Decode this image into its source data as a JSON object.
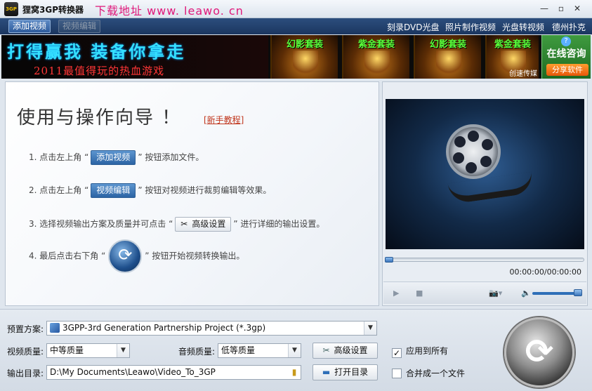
{
  "window": {
    "title": "狸窝3GP转换器",
    "logo_text": "3GP",
    "promo_text": "下载地址 www. leawo. cn",
    "controls": {
      "minimize": "—",
      "maximize": "▫",
      "close": "✕"
    }
  },
  "toolbar": {
    "add_video": "添加视频",
    "edit_video": "视频编辑",
    "links": [
      "刻录DVD光盘",
      "照片制作视频",
      "光盘转视频",
      "德州扑克"
    ]
  },
  "banner": {
    "slogan": "打得赢我  装备你拿走",
    "subtitle": "2011最值得玩的热血游戏",
    "cards": [
      {
        "label": "幻影套装",
        "extra": ""
      },
      {
        "label": "紫金套装",
        "extra": ""
      },
      {
        "label": "幻影套装",
        "extra": ""
      },
      {
        "label": "紫金套装",
        "extra": "创速传媒"
      }
    ],
    "consult_icon": "?",
    "consult_title": "在线咨询",
    "share_label": "分享软件"
  },
  "guide": {
    "title": "使用与操作向导 ！",
    "tutorial_link": "[新手教程]",
    "step1_pre": "1. 点击左上角 “",
    "step1_btn": "添加视频",
    "step1_post": "” 按钮添加文件。",
    "step2_pre": "2. 点击左上角 “",
    "step2_btn": "视频编辑",
    "step2_post": "” 按钮对视频进行裁剪编辑等效果。",
    "step3_pre": "3. 选择视频输出方案及质量并可点击 “",
    "step3_btn": "高级设置",
    "step3_post": "” 进行详细的输出设置。",
    "step4_pre": "4. 最后点击右下角 “",
    "step4_post": "” 按钮开始视频转换输出。"
  },
  "preview": {
    "time": "00:00:00/00:00:00",
    "seek_position": 0,
    "volume_level": 0.9
  },
  "output": {
    "preset_label": "预置方案:",
    "preset_value": "3GPP-3rd Generation Partnership Project (*.3gp)",
    "video_quality_label": "视频质量:",
    "video_quality_value": "中等质量",
    "audio_quality_label": "音频质量:",
    "audio_quality_value": "低等质量",
    "advanced_label": "高级设置",
    "apply_all_label": "应用到所有",
    "apply_all_checked": true,
    "output_dir_label": "输出目录:",
    "output_dir_value": "D:\\My Documents\\Leawo\\Video_To_3GP",
    "open_dir_label": "打开目录",
    "merge_label": "合并成一个文件",
    "merge_checked": false
  },
  "colors": {
    "toolbar_bg": "#1b3660",
    "accent_blue": "#2c64a4",
    "promo_pink": "#e0187a",
    "link_red": "#c0351c"
  }
}
